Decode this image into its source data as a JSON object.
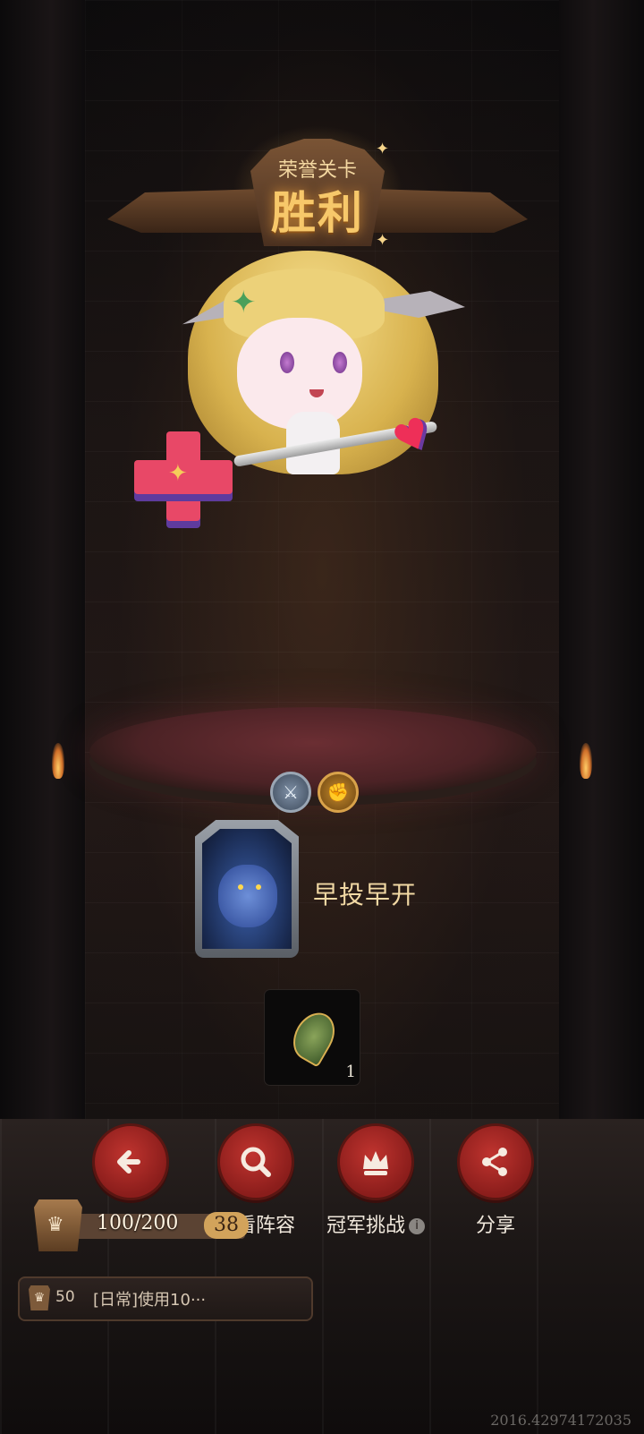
{
  "banner": {
    "subtitle": "荣誉关卡",
    "title": "胜利"
  },
  "hero": {
    "name": "hero-character"
  },
  "player": {
    "name": "早投早开"
  },
  "reward": {
    "count": "1"
  },
  "actions": [
    {
      "label": "返回",
      "icon": "back-arrow-icon"
    },
    {
      "label": "查看阵容",
      "icon": "magnifier-icon"
    },
    {
      "label": "冠军挑战",
      "icon": "crown-icon"
    },
    {
      "label": "分享",
      "icon": "share-icon"
    }
  ],
  "level": {
    "progress": "100/200",
    "level": "38"
  },
  "quest": {
    "points": "50",
    "text": "[日常]使用10···"
  },
  "footer": {
    "coords": "2016.42974172035"
  },
  "colors": {
    "accent_red": "#b12c28",
    "title_gold": "#f7c86a"
  }
}
